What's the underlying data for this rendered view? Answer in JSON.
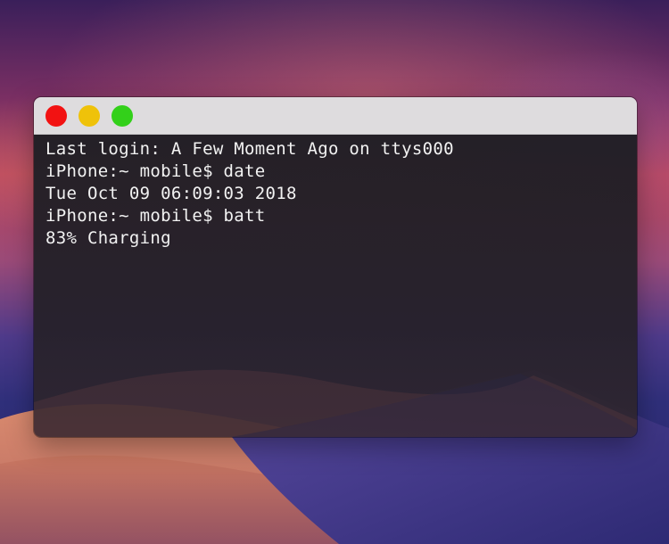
{
  "window": {
    "controls": [
      {
        "name": "close",
        "color": "#f21212"
      },
      {
        "name": "minimize",
        "color": "#efc20a"
      },
      {
        "name": "zoom",
        "color": "#33d01a"
      }
    ]
  },
  "terminal": {
    "lines": [
      "Last login: A Few Moment Ago on ttys000",
      "iPhone:~ mobile$ date",
      "Tue Oct 09 06:09:03 2018",
      "iPhone:~ mobile$ batt",
      "83% Charging"
    ]
  }
}
